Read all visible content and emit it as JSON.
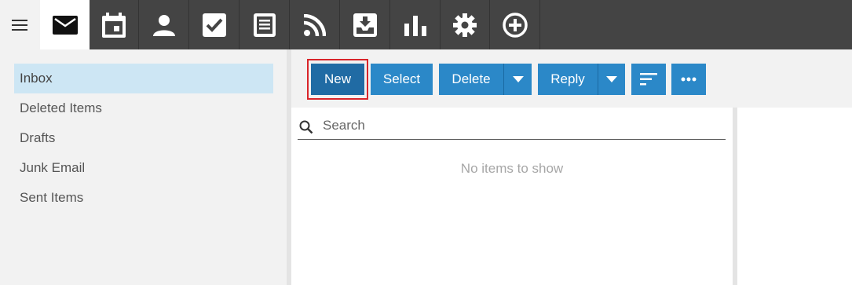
{
  "app_bar": {
    "menu_icon": "hamburger-icon",
    "apps": [
      {
        "name": "mail",
        "icon": "mail-icon",
        "active": true
      },
      {
        "name": "calendar",
        "icon": "calendar-icon"
      },
      {
        "name": "contacts",
        "icon": "person-icon"
      },
      {
        "name": "tasks",
        "icon": "checkbox-icon"
      },
      {
        "name": "notes",
        "icon": "notes-icon"
      },
      {
        "name": "feeds",
        "icon": "rss-icon"
      },
      {
        "name": "inbox-download",
        "icon": "download-tray-icon"
      },
      {
        "name": "reports",
        "icon": "bar-chart-icon"
      },
      {
        "name": "settings",
        "icon": "gear-icon"
      },
      {
        "name": "add",
        "icon": "plus-circle-icon"
      }
    ]
  },
  "sidebar": {
    "folders": [
      {
        "label": "Inbox",
        "selected": true
      },
      {
        "label": "Deleted Items"
      },
      {
        "label": "Drafts"
      },
      {
        "label": "Junk Email"
      },
      {
        "label": "Sent Items"
      }
    ]
  },
  "toolbar": {
    "new_label": "New",
    "select_label": "Select",
    "delete_label": "Delete",
    "reply_label": "Reply",
    "sort_icon": "sort-lines-icon",
    "more_icon": "ellipsis-icon"
  },
  "list": {
    "search_placeholder": "Search",
    "empty_text": "No items to show"
  },
  "colors": {
    "topbar": "#444444",
    "button": "#2b88c8",
    "button_focused": "#206ba4",
    "selected_folder": "#cde6f4",
    "focus_outline": "#d9252a"
  }
}
